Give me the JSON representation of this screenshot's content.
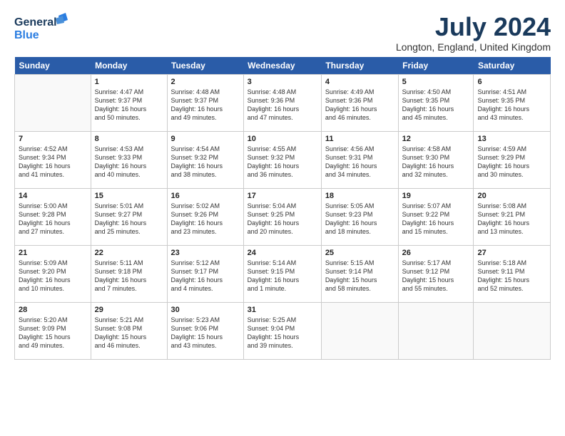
{
  "header": {
    "logo_general": "General",
    "logo_blue": "Blue",
    "month_title": "July 2024",
    "location": "Longton, England, United Kingdom"
  },
  "days_of_week": [
    "Sunday",
    "Monday",
    "Tuesday",
    "Wednesday",
    "Thursday",
    "Friday",
    "Saturday"
  ],
  "weeks": [
    [
      {
        "day": "",
        "info": ""
      },
      {
        "day": "1",
        "info": "Sunrise: 4:47 AM\nSunset: 9:37 PM\nDaylight: 16 hours\nand 50 minutes."
      },
      {
        "day": "2",
        "info": "Sunrise: 4:48 AM\nSunset: 9:37 PM\nDaylight: 16 hours\nand 49 minutes."
      },
      {
        "day": "3",
        "info": "Sunrise: 4:48 AM\nSunset: 9:36 PM\nDaylight: 16 hours\nand 47 minutes."
      },
      {
        "day": "4",
        "info": "Sunrise: 4:49 AM\nSunset: 9:36 PM\nDaylight: 16 hours\nand 46 minutes."
      },
      {
        "day": "5",
        "info": "Sunrise: 4:50 AM\nSunset: 9:35 PM\nDaylight: 16 hours\nand 45 minutes."
      },
      {
        "day": "6",
        "info": "Sunrise: 4:51 AM\nSunset: 9:35 PM\nDaylight: 16 hours\nand 43 minutes."
      }
    ],
    [
      {
        "day": "7",
        "info": "Sunrise: 4:52 AM\nSunset: 9:34 PM\nDaylight: 16 hours\nand 41 minutes."
      },
      {
        "day": "8",
        "info": "Sunrise: 4:53 AM\nSunset: 9:33 PM\nDaylight: 16 hours\nand 40 minutes."
      },
      {
        "day": "9",
        "info": "Sunrise: 4:54 AM\nSunset: 9:32 PM\nDaylight: 16 hours\nand 38 minutes."
      },
      {
        "day": "10",
        "info": "Sunrise: 4:55 AM\nSunset: 9:32 PM\nDaylight: 16 hours\nand 36 minutes."
      },
      {
        "day": "11",
        "info": "Sunrise: 4:56 AM\nSunset: 9:31 PM\nDaylight: 16 hours\nand 34 minutes."
      },
      {
        "day": "12",
        "info": "Sunrise: 4:58 AM\nSunset: 9:30 PM\nDaylight: 16 hours\nand 32 minutes."
      },
      {
        "day": "13",
        "info": "Sunrise: 4:59 AM\nSunset: 9:29 PM\nDaylight: 16 hours\nand 30 minutes."
      }
    ],
    [
      {
        "day": "14",
        "info": "Sunrise: 5:00 AM\nSunset: 9:28 PM\nDaylight: 16 hours\nand 27 minutes."
      },
      {
        "day": "15",
        "info": "Sunrise: 5:01 AM\nSunset: 9:27 PM\nDaylight: 16 hours\nand 25 minutes."
      },
      {
        "day": "16",
        "info": "Sunrise: 5:02 AM\nSunset: 9:26 PM\nDaylight: 16 hours\nand 23 minutes."
      },
      {
        "day": "17",
        "info": "Sunrise: 5:04 AM\nSunset: 9:25 PM\nDaylight: 16 hours\nand 20 minutes."
      },
      {
        "day": "18",
        "info": "Sunrise: 5:05 AM\nSunset: 9:23 PM\nDaylight: 16 hours\nand 18 minutes."
      },
      {
        "day": "19",
        "info": "Sunrise: 5:07 AM\nSunset: 9:22 PM\nDaylight: 16 hours\nand 15 minutes."
      },
      {
        "day": "20",
        "info": "Sunrise: 5:08 AM\nSunset: 9:21 PM\nDaylight: 16 hours\nand 13 minutes."
      }
    ],
    [
      {
        "day": "21",
        "info": "Sunrise: 5:09 AM\nSunset: 9:20 PM\nDaylight: 16 hours\nand 10 minutes."
      },
      {
        "day": "22",
        "info": "Sunrise: 5:11 AM\nSunset: 9:18 PM\nDaylight: 16 hours\nand 7 minutes."
      },
      {
        "day": "23",
        "info": "Sunrise: 5:12 AM\nSunset: 9:17 PM\nDaylight: 16 hours\nand 4 minutes."
      },
      {
        "day": "24",
        "info": "Sunrise: 5:14 AM\nSunset: 9:15 PM\nDaylight: 16 hours\nand 1 minute."
      },
      {
        "day": "25",
        "info": "Sunrise: 5:15 AM\nSunset: 9:14 PM\nDaylight: 15 hours\nand 58 minutes."
      },
      {
        "day": "26",
        "info": "Sunrise: 5:17 AM\nSunset: 9:12 PM\nDaylight: 15 hours\nand 55 minutes."
      },
      {
        "day": "27",
        "info": "Sunrise: 5:18 AM\nSunset: 9:11 PM\nDaylight: 15 hours\nand 52 minutes."
      }
    ],
    [
      {
        "day": "28",
        "info": "Sunrise: 5:20 AM\nSunset: 9:09 PM\nDaylight: 15 hours\nand 49 minutes."
      },
      {
        "day": "29",
        "info": "Sunrise: 5:21 AM\nSunset: 9:08 PM\nDaylight: 15 hours\nand 46 minutes."
      },
      {
        "day": "30",
        "info": "Sunrise: 5:23 AM\nSunset: 9:06 PM\nDaylight: 15 hours\nand 43 minutes."
      },
      {
        "day": "31",
        "info": "Sunrise: 5:25 AM\nSunset: 9:04 PM\nDaylight: 15 hours\nand 39 minutes."
      },
      {
        "day": "",
        "info": ""
      },
      {
        "day": "",
        "info": ""
      },
      {
        "day": "",
        "info": ""
      }
    ]
  ]
}
